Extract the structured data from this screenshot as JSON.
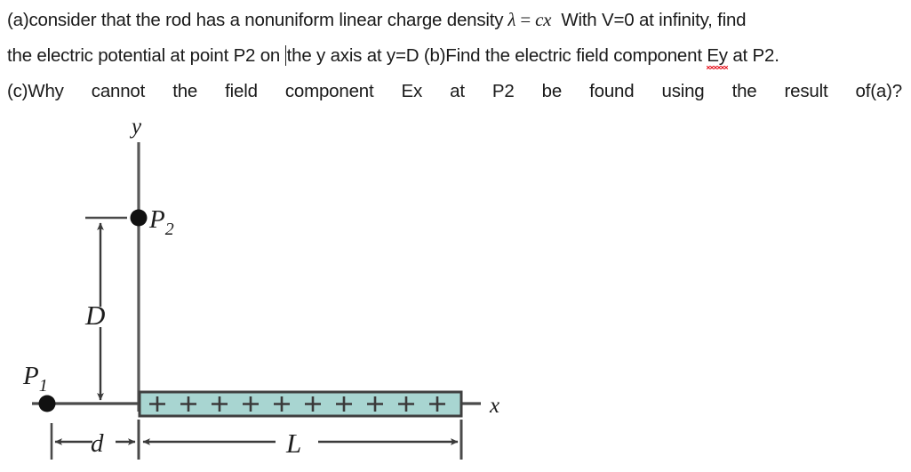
{
  "problem": {
    "line1": {
      "part_a": "(a)consider that the rod has a nonuniform linear charge density",
      "lambda": "λ",
      "equals": "=",
      "cx": "cx",
      "tail": "With V=0 at infinity, find"
    },
    "line2": {
      "before_caret": "the electric potential at point P2 on",
      "after_caret": "the y axis at y=D (b)Find the electric field component",
      "misspelled_word": "Ey",
      "tail": "at P2."
    },
    "line3": {
      "words": [
        "(c)Why",
        "cannot",
        "the",
        "field",
        "component",
        "Ex",
        "at",
        "P2",
        "be",
        "found",
        "using",
        "the",
        "result",
        "of(a)?"
      ]
    }
  },
  "figure": {
    "axis_label_y": "y",
    "axis_label_x": "x",
    "point_p1": "P",
    "point_p1_sub": "1",
    "point_p2": "P",
    "point_p2_sub": "2",
    "dimension_d_vertical": "D",
    "dimension_d_horizontal": "d",
    "dimension_l": "L",
    "rod_charge_symbol": "+",
    "rod_charge_count": 10,
    "colors": {
      "rod_fill": "#a8d5d1",
      "rod_stroke": "#3f3f3f",
      "axis_stroke": "#555555",
      "label_color": "#1d1d1d",
      "spellcheck_underline": "#e8202a"
    }
  }
}
